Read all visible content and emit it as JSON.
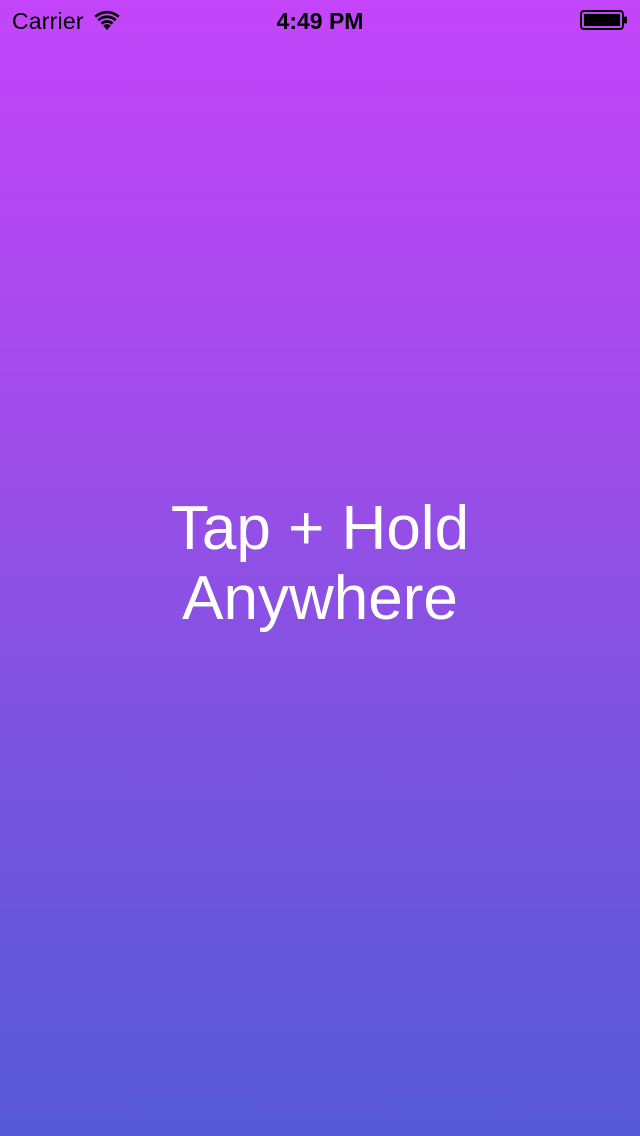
{
  "status_bar": {
    "carrier": "Carrier",
    "time": "4:49 PM",
    "icons": {
      "signal": "wifi-icon",
      "battery": "battery-icon"
    }
  },
  "main": {
    "instruction_line1": "Tap + Hold",
    "instruction_line2": "Anywhere"
  },
  "colors": {
    "gradient_top": "#c445fb",
    "gradient_bottom": "#5559d6",
    "text": "#ffffff",
    "status_text": "#000000"
  }
}
